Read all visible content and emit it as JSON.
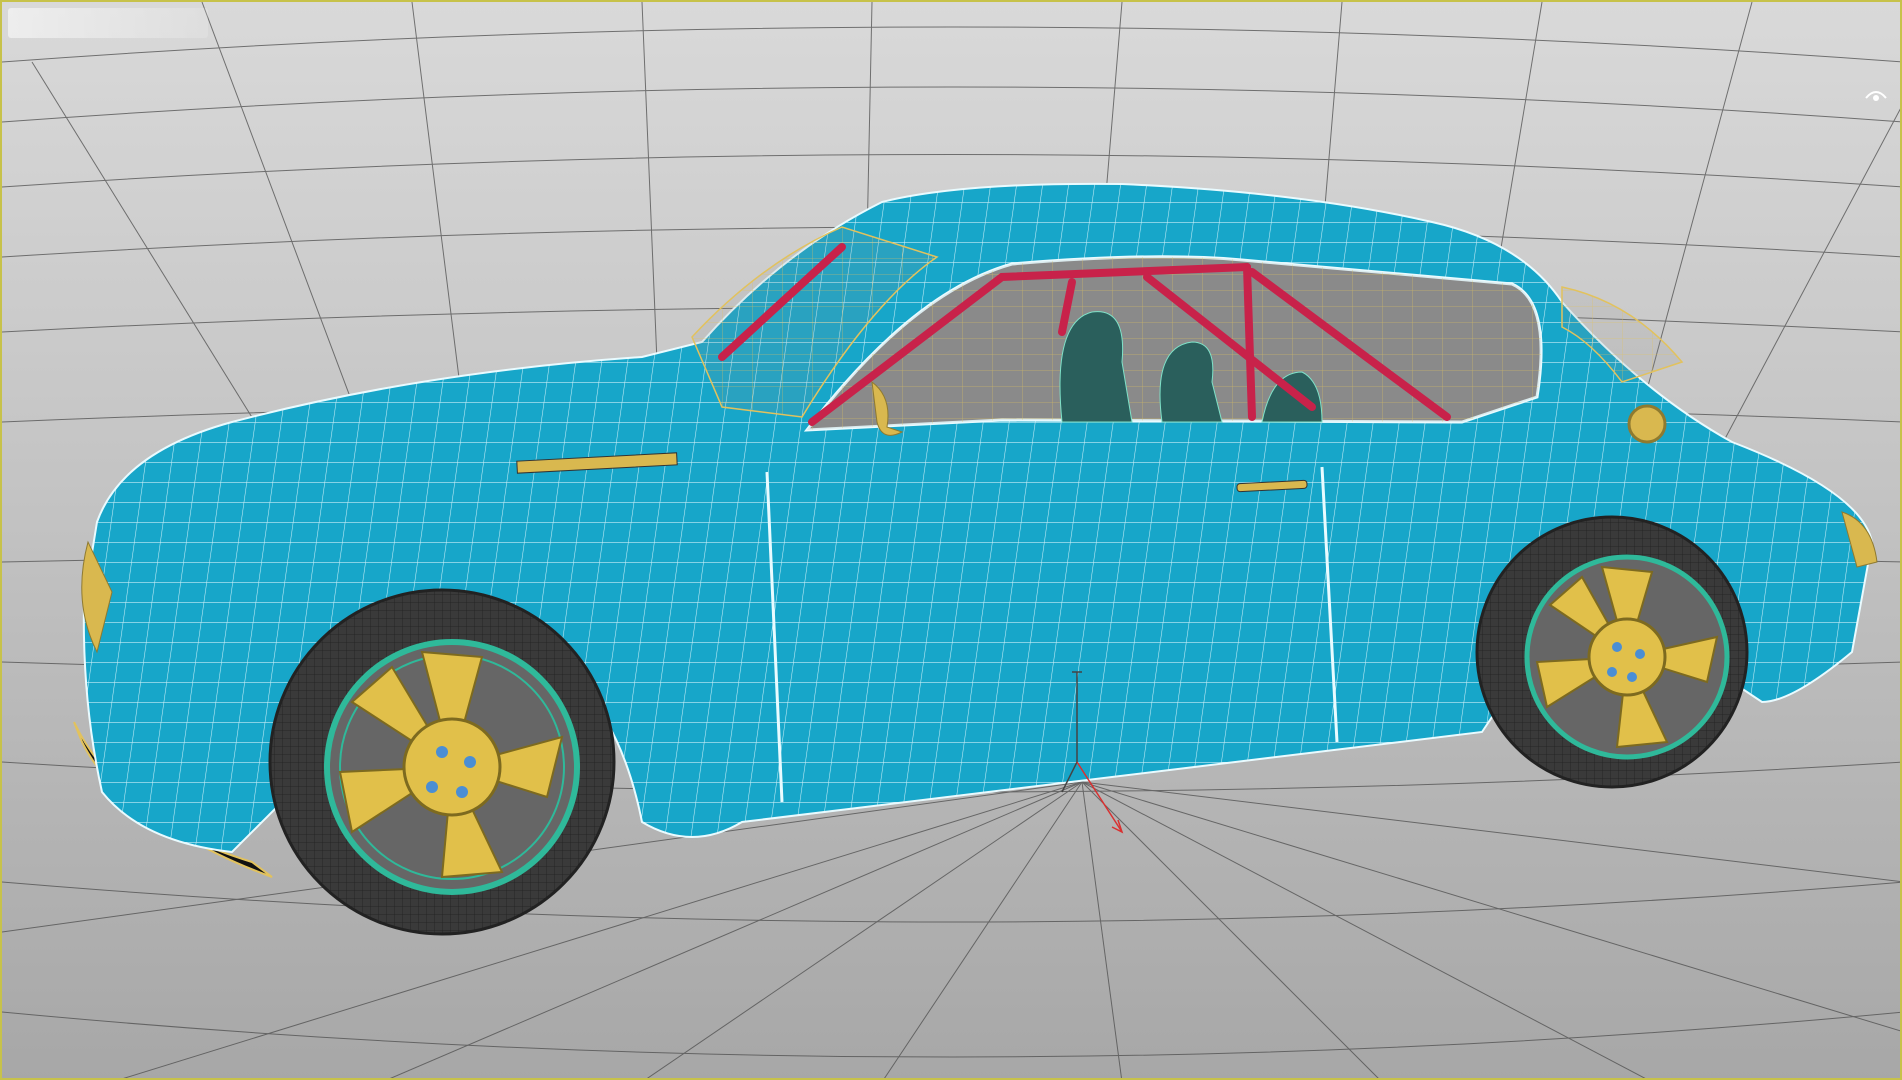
{
  "viewport": {
    "label": "",
    "mode": "wireframe-on-shaded",
    "selection_color": "#c7c24a",
    "background_top": "#d5d5d5",
    "background_bottom": "#a9a9a9",
    "grid_color": "#4a4a4a"
  },
  "scene": {
    "object": "car",
    "body_color": "#1aa9cc",
    "wire_color": "#ffffff",
    "wheel_color": "#e1c04a",
    "tire_color": "#333333",
    "rim_ring_color": "#2fb99a",
    "cage_color": "#c8224a",
    "glass_wire_color": "#e2c25d",
    "hub_color": "#4a8ed4"
  },
  "gizmos": {
    "view_cube": "view-cube-icon",
    "pivot": "pivot-axis-icon",
    "axis_x_color": "#d93030",
    "axis_y_color": "#444444"
  }
}
